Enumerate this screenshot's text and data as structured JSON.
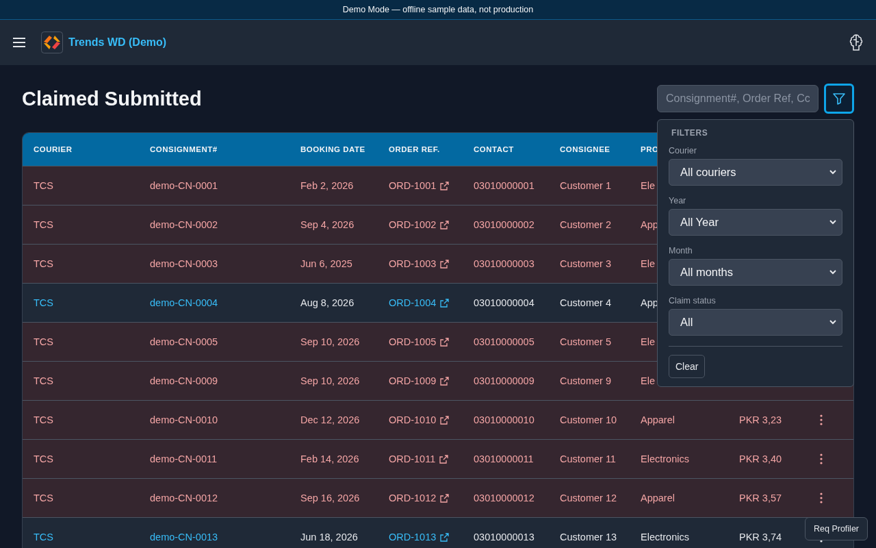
{
  "banner": "Demo Mode — offline sample data, not production",
  "app": {
    "title": "Trends WD (Demo)"
  },
  "page": {
    "title": "Claimed Submitted",
    "search": {
      "placeholder": "Consignment#, Order Ref, Cc"
    },
    "filter_button": {
      "active": true
    }
  },
  "table": {
    "columns": [
      {
        "label": "COURIER"
      },
      {
        "label": "CONSIGNMENT#"
      },
      {
        "label": "BOOKING DATE"
      },
      {
        "label": "ORDER REF."
      },
      {
        "label": "CONTACT"
      },
      {
        "label": "CONSIGNEE"
      },
      {
        "label": "PRO"
      }
    ],
    "rows": [
      {
        "flagged": true,
        "courier": "TCS",
        "consignment": "demo-CN-0001",
        "date": "Feb 2, 2026",
        "order": "ORD-1001",
        "contact": "03010000001",
        "consignee": "Customer 1",
        "product": "Ele"
      },
      {
        "flagged": true,
        "courier": "TCS",
        "consignment": "demo-CN-0002",
        "date": "Sep 4, 2026",
        "order": "ORD-1002",
        "contact": "03010000002",
        "consignee": "Customer 2",
        "product": "App"
      },
      {
        "flagged": true,
        "courier": "TCS",
        "consignment": "demo-CN-0003",
        "date": "Jun 6, 2025",
        "order": "ORD-1003",
        "contact": "03010000003",
        "consignee": "Customer 3",
        "product": "Ele"
      },
      {
        "flagged": false,
        "courier": "TCS",
        "consignment": "demo-CN-0004",
        "date": "Aug 8, 2026",
        "order": "ORD-1004",
        "contact": "03010000004",
        "consignee": "Customer 4",
        "product": "App"
      },
      {
        "flagged": true,
        "courier": "TCS",
        "consignment": "demo-CN-0005",
        "date": "Sep 10, 2026",
        "order": "ORD-1005",
        "contact": "03010000005",
        "consignee": "Customer 5",
        "product": "Ele"
      },
      {
        "flagged": true,
        "courier": "TCS",
        "consignment": "demo-CN-0009",
        "date": "Sep 10, 2026",
        "order": "ORD-1009",
        "contact": "03010000009",
        "consignee": "Customer 9",
        "product": "Ele"
      },
      {
        "flagged": true,
        "courier": "TCS",
        "consignment": "demo-CN-0010",
        "date": "Dec 12, 2026",
        "order": "ORD-1010",
        "contact": "03010000010",
        "consignee": "Customer 10",
        "product": "Apparel",
        "amount": "PKR 3,23"
      },
      {
        "flagged": true,
        "courier": "TCS",
        "consignment": "demo-CN-0011",
        "date": "Feb 14, 2026",
        "order": "ORD-1011",
        "contact": "03010000011",
        "consignee": "Customer 11",
        "product": "Electronics",
        "amount": "PKR 3,40"
      },
      {
        "flagged": true,
        "courier": "TCS",
        "consignment": "demo-CN-0012",
        "date": "Sep 16, 2026",
        "order": "ORD-1012",
        "contact": "03010000012",
        "consignee": "Customer 12",
        "product": "Apparel",
        "amount": "PKR 3,57"
      },
      {
        "flagged": false,
        "courier": "TCS",
        "consignment": "demo-CN-0013",
        "date": "Jun 18, 2026",
        "order": "ORD-1013",
        "contact": "03010000013",
        "consignee": "Customer 13",
        "product": "Electronics",
        "amount": "PKR 3,74"
      }
    ]
  },
  "filters": {
    "title": "FILTERS",
    "fields": [
      {
        "label": "Courier",
        "value": "All couriers"
      },
      {
        "label": "Year",
        "value": "All Year"
      },
      {
        "label": "Month",
        "value": "All months"
      },
      {
        "label": "Claim status",
        "value": "All"
      }
    ],
    "clear": "Clear"
  },
  "profiler": "Req Profiler"
}
